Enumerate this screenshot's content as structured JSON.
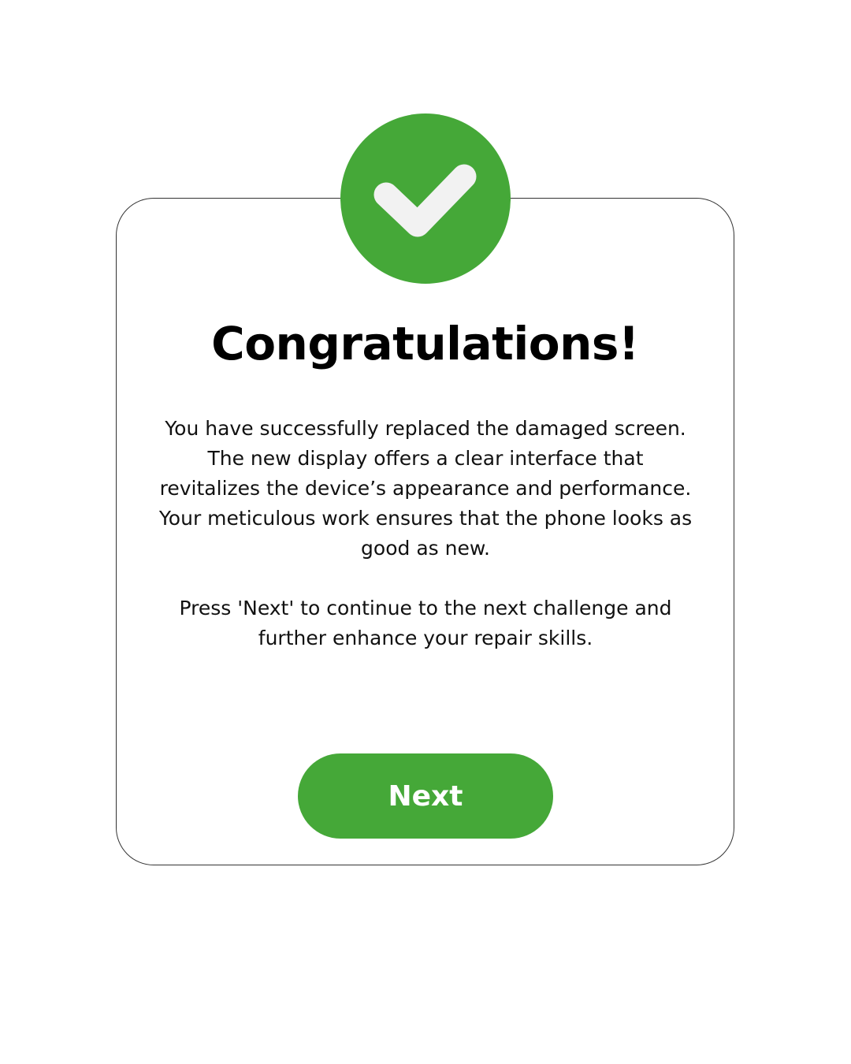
{
  "dialog": {
    "icon": "checkmark-icon",
    "title": "Congratulations!",
    "message_paragraph_1": "You have successfully replaced the damaged screen. The new display offers a clear interface that revitalizes the device’s appearance and performance. Your meticulous work ensures that the phone looks as good as new.",
    "message_paragraph_2": "Press 'Next' to continue to the next challenge and further enhance your repair skills.",
    "next_label": "Next"
  },
  "colors": {
    "accent": "#45a838",
    "check_mark": "#f2f2f2",
    "text": "#000000",
    "background": "#ffffff"
  }
}
